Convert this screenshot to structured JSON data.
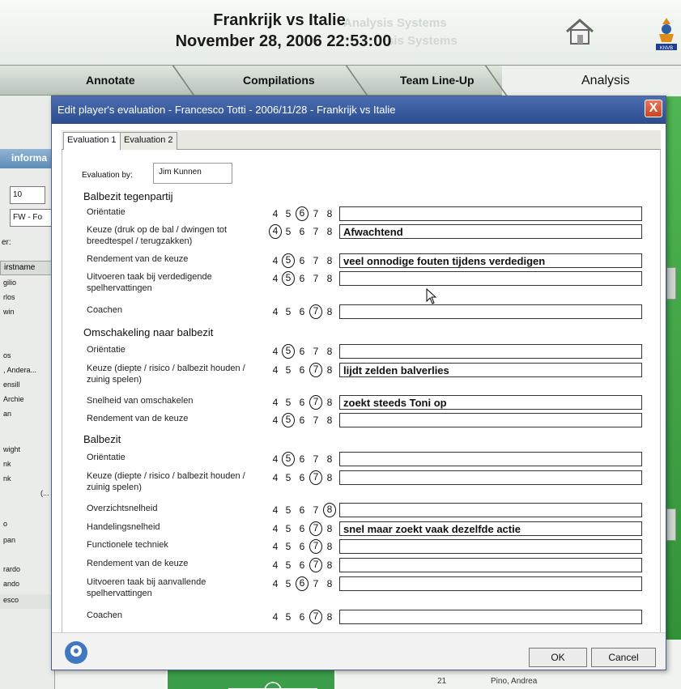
{
  "header": {
    "title": "Frankrijk vs Italie",
    "date": "November 28, 2006 22:53:00",
    "watermark_line1": "Analysis Systems",
    "watermark_line2": "sis Systems"
  },
  "nav": {
    "annotate": "Annotate",
    "compilations": "Compilations",
    "lineup": "Team Line-Up",
    "analysis": "Analysis"
  },
  "left_panel": {
    "info_header": "informa",
    "number_value": "10",
    "position_value": "FW - Fo",
    "label_er": "er:",
    "list_header": "irstname",
    "rows": [
      "gilio",
      "rlos",
      "win",
      "os",
      ", Andera...",
      "ensill",
      "Archie",
      "an",
      "wight",
      "nk",
      "nk",
      "(...",
      "o",
      "pan",
      "rardo",
      "ando",
      "esco"
    ]
  },
  "dialog": {
    "title": "Edit player's evaluation - Francesco Totti - 2006/11/28 - Frankrijk vs Italie",
    "close": "X",
    "tabs": [
      "Evaluation 1",
      "Evaluation 2"
    ],
    "evaluation_by_label": "Evaluation by:",
    "evaluator": "Jim Kunnen",
    "sections": [
      {
        "title": "Balbezit tegenpartij"
      },
      {
        "title": "Omschakeling naar balbezit"
      },
      {
        "title": "Balbezit"
      }
    ],
    "criteria": [
      {
        "label": "Oriëntatie",
        "score": 6,
        "comment": ""
      },
      {
        "label": "Keuze (druk op de bal / dwingen tot breedtespel / terugzakken)",
        "score": 4,
        "comment": "Afwachtend"
      },
      {
        "label": "Rendement van de keuze",
        "score": 5,
        "comment": "veel onnodige fouten tijdens verdedigen"
      },
      {
        "label": "Uitvoeren taak bij verdedigende spelhervattingen",
        "score": 5,
        "comment": ""
      },
      {
        "label": "Coachen",
        "score": 7,
        "comment": ""
      },
      {
        "label": "Oriëntatie",
        "score": 5,
        "comment": ""
      },
      {
        "label": "Keuze (diepte / risico / balbezit houden / zuinig spelen)",
        "score": 7,
        "comment": "lijdt zelden balverlies"
      },
      {
        "label": "Snelheid van omschakelen",
        "score": 7,
        "comment": "zoekt steeds Toni op"
      },
      {
        "label": "Rendement van de keuze",
        "score": 5,
        "comment": ""
      },
      {
        "label": "Oriëntatie",
        "score": 5,
        "comment": ""
      },
      {
        "label": "Keuze (diepte / risico / balbezit houden / zuinig spelen)",
        "score": 7,
        "comment": ""
      },
      {
        "label": "Overzichtsnelheid",
        "score": 8,
        "comment": ""
      },
      {
        "label": "Handelingsnelheid",
        "score": 7,
        "comment": "snel maar zoekt vaak dezelfde actie"
      },
      {
        "label": "Functionele techniek",
        "score": 7,
        "comment": ""
      },
      {
        "label": "Rendement van de keuze",
        "score": 7,
        "comment": ""
      },
      {
        "label": "Uitvoeren taak bij aanvallende spelhervattingen",
        "score": 6,
        "comment": ""
      },
      {
        "label": "Coachen",
        "score": 7,
        "comment": ""
      }
    ],
    "score_options": [
      "4",
      "5",
      "6",
      "7",
      "8"
    ],
    "ok_label": "OK",
    "cancel_label": "Cancel"
  },
  "bottom": {
    "row_number": "21",
    "row_name": "Pino, Andrea"
  }
}
